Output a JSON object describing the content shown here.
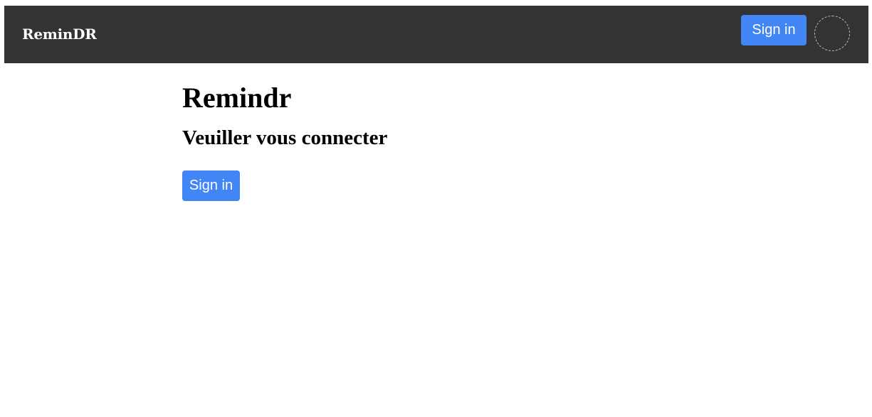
{
  "navbar": {
    "brand": "ReminDR",
    "signin_label": "Sign in",
    "avatar_icon": "user-avatar-icon",
    "background": "#333333"
  },
  "main": {
    "title": "Remindr",
    "subtitle": "Veuiller vous connecter",
    "signin_label": "Sign in"
  },
  "colors": {
    "accent": "#4285f4"
  }
}
